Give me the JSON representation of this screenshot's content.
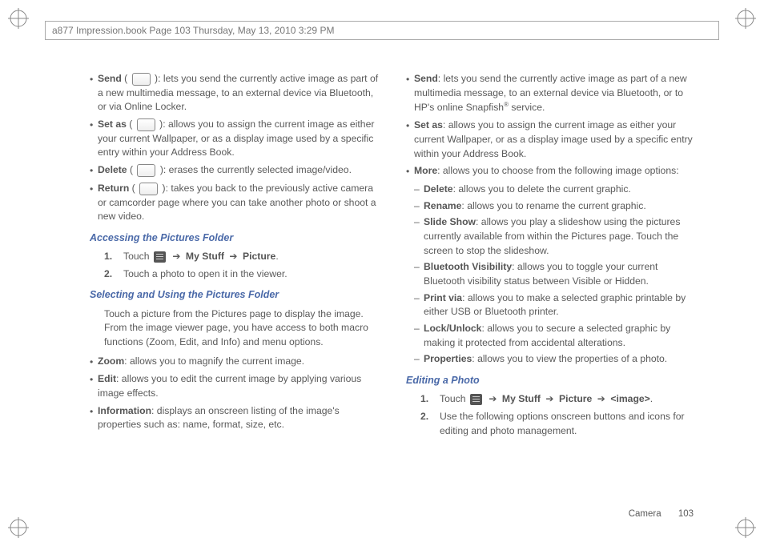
{
  "header": "a877 Impression.book  Page 103  Thursday, May 13, 2010  3:29 PM",
  "footer": {
    "section": "Camera",
    "page": "103"
  },
  "left": {
    "b1": {
      "term": "Send",
      "rest": " ( ",
      "tail": " ): lets you send the currently active image as part of a new multimedia message, to an external device via Bluetooth, or via Online Locker."
    },
    "b2": {
      "term": "Set as",
      "rest": " ( ",
      "tail": " ): allows you to assign the current image as either your current Wallpaper, or as a display image used by a specific entry within your Address Book."
    },
    "b3": {
      "term": "Delete",
      "rest": " ( ",
      "tail": " ): erases the currently selected image/video."
    },
    "b4": {
      "term": "Return",
      "rest": " ( ",
      "tail": " ): takes you back to the previously active camera or camcorder page where you can take another photo or shoot a new video."
    },
    "h1": "Accessing the Pictures Folder",
    "s1_pre": "Touch ",
    "s1_bold1": "My Stuff",
    "s1_bold2": "Picture",
    "s2": "Touch a photo to open it in the viewer.",
    "h2": "Selecting and Using the Pictures Folder",
    "para": "Touch a picture from the Pictures page to display the image. From the image viewer page, you have access to both macro functions (Zoom, Edit, and Info) and menu options.",
    "b5": {
      "term": "Zoom",
      "tail": ": allows you to magnify the current image."
    },
    "b6": {
      "term": "Edit",
      "tail": ": allows you to edit the current image by applying various image effects."
    },
    "b7": {
      "term": "Information",
      "tail": ": displays an onscreen listing of the image's properties such as: name, format, size, etc."
    }
  },
  "right": {
    "b1": {
      "term": "Send",
      "tail": ": lets you send the currently active image as part of a new multimedia message, to an external device via Bluetooth, or to HP's online Snapfish",
      "sup": "®",
      "tail2": " service."
    },
    "b2": {
      "term": "Set as",
      "tail": ": allows you to assign the current image as either your current Wallpaper, or as a display image used by a specific entry within your Address Book."
    },
    "b3": {
      "term": "More",
      "tail": ": allows you to choose from the following image options:"
    },
    "sub": {
      "s1": {
        "term": "Delete",
        "tail": ": allows you to delete the current graphic."
      },
      "s2": {
        "term": "Rename",
        "tail": ": allows you to rename the current graphic."
      },
      "s3": {
        "term": "Slide Show",
        "tail": ": allows you play a slideshow using the pictures currently available from within the Pictures page. Touch the screen to stop the slideshow."
      },
      "s4": {
        "term": "Bluetooth Visibility",
        "tail": ": allows you to toggle your current Bluetooth visibility status between Visible or Hidden."
      },
      "s5": {
        "term": "Print via",
        "tail": ": allows you to make a selected graphic printable by either USB or Bluetooth printer."
      },
      "s6": {
        "term": "Lock/Unlock",
        "tail": ": allows you to secure a selected graphic by making it protected from accidental alterations."
      },
      "s7": {
        "term": "Properties",
        "tail": ": allows you to view the properties of a photo."
      }
    },
    "h1": "Editing a Photo",
    "s1_pre": "Touch ",
    "s1_b1": "My Stuff",
    "s1_b2": "Picture",
    "s1_b3": "<image>",
    "s2": "Use the following options onscreen buttons and icons for editing and photo management."
  },
  "glyph": {
    "arrow": "➔",
    "bullet": "•",
    "dash": "–"
  }
}
